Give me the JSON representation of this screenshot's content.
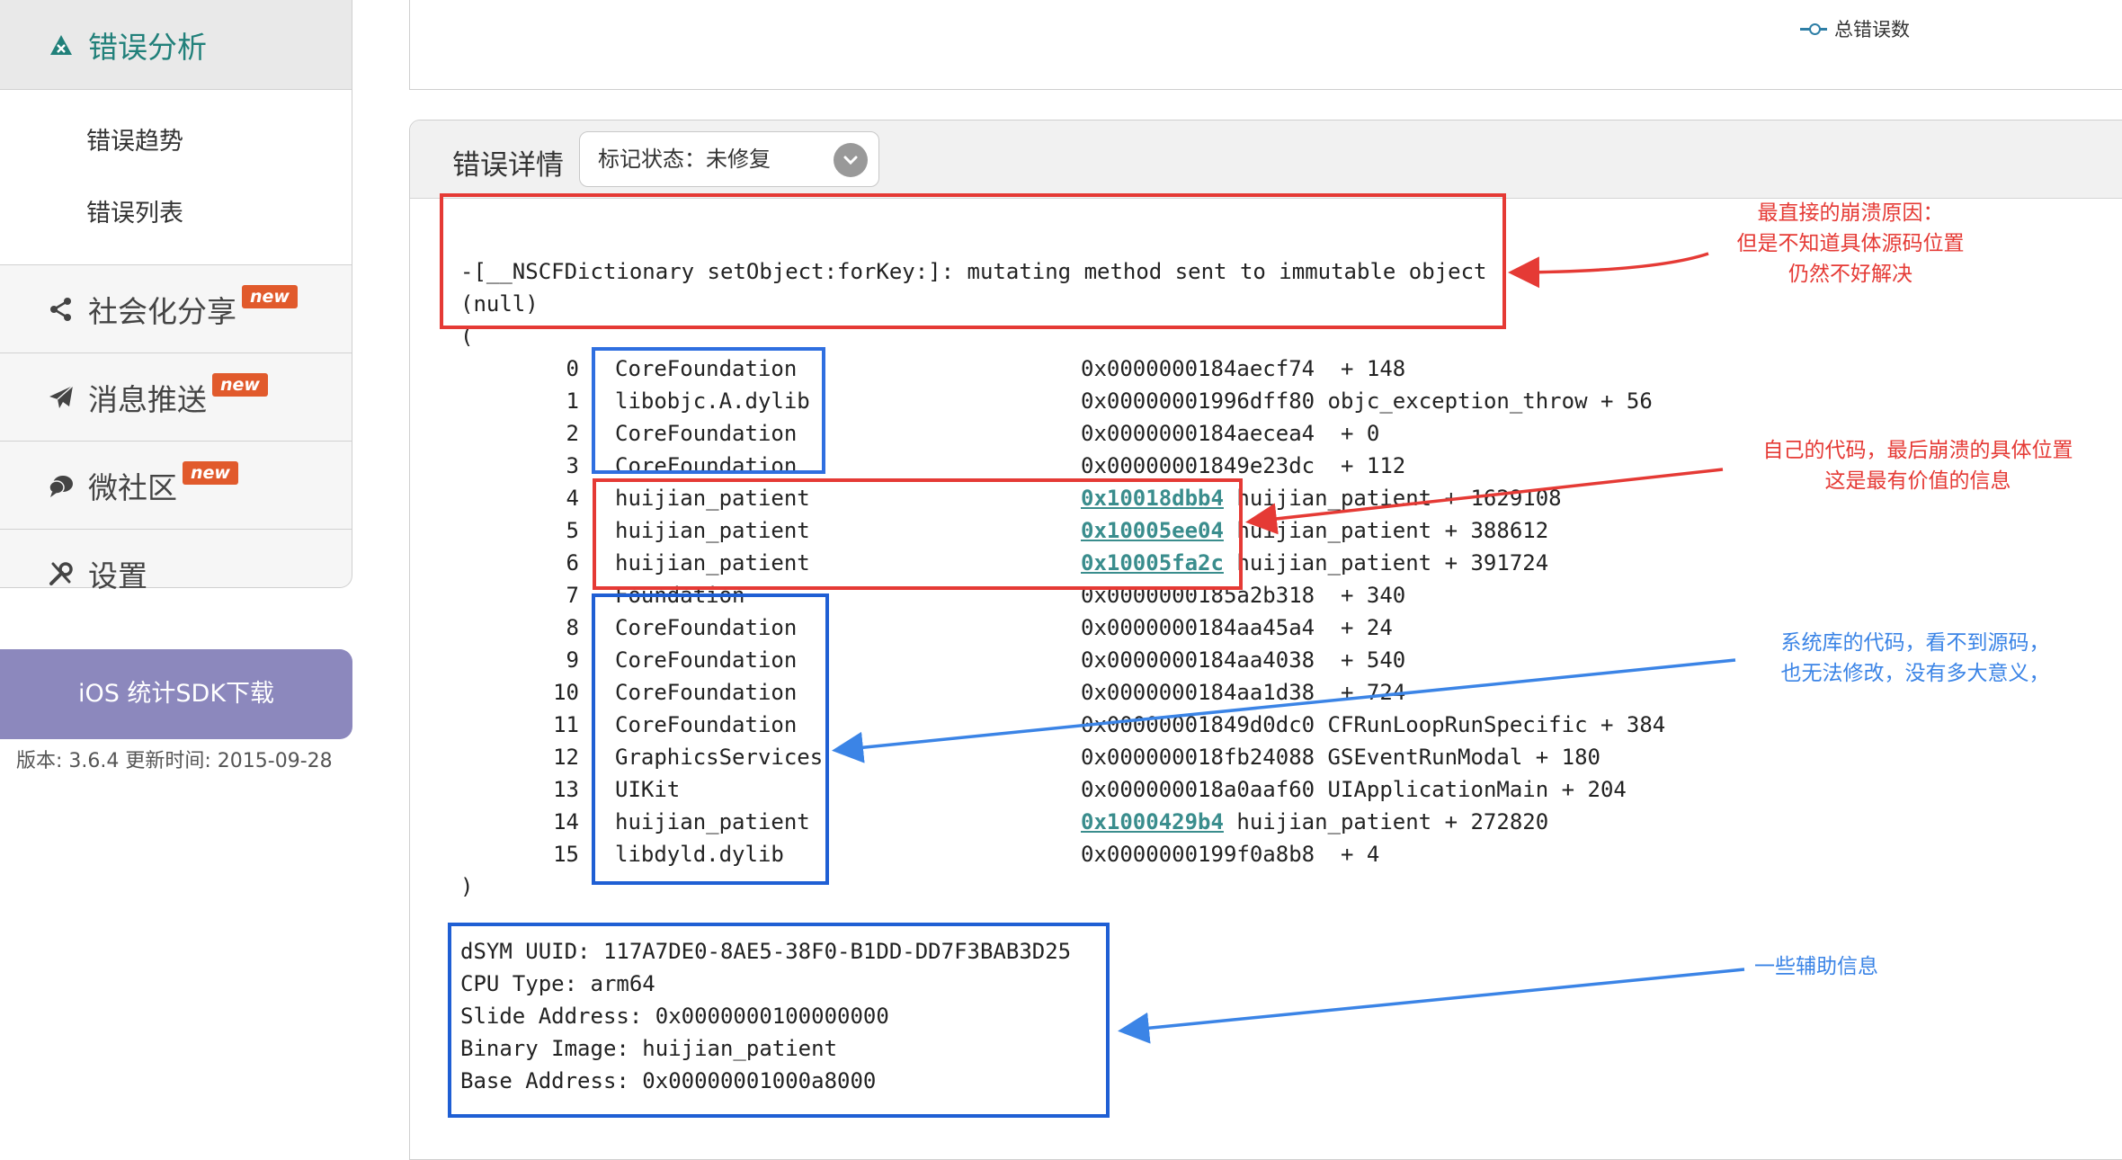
{
  "sidebar": {
    "active_item": "错误分析",
    "sub_items": [
      "错误趋势",
      "错误列表"
    ],
    "items": [
      {
        "label": "社会化分享",
        "badge": "new"
      },
      {
        "label": "消息推送",
        "badge": "new"
      },
      {
        "label": "微社区",
        "badge": "new"
      },
      {
        "label": "设置",
        "badge": ""
      }
    ],
    "sdk_button": "iOS 统计SDK下载",
    "version": "版本: 3.6.4 更新时间: 2015-09-28"
  },
  "chart": {
    "legend": "总错误数"
  },
  "detail": {
    "title": "错误详情",
    "status_select": "标记状态：未修复",
    "exception_line1": "-[__NSCFDictionary setObject:forKey:]: mutating method sent to immutable object",
    "exception_line2": "(null)",
    "open_paren": "(",
    "close_paren": ")",
    "frames": [
      {
        "idx": "0",
        "lib": "CoreFoundation",
        "addr": "0x0000000184aecf74",
        "rest": " + 148",
        "link": false
      },
      {
        "idx": "1",
        "lib": "libobjc.A.dylib",
        "addr": "0x00000001996dff80",
        "rest": "objc_exception_throw + 56",
        "link": false
      },
      {
        "idx": "2",
        "lib": "CoreFoundation",
        "addr": "0x0000000184aecea4",
        "rest": " + 0",
        "link": false
      },
      {
        "idx": "3",
        "lib": "CoreFoundation",
        "addr": "0x00000001849e23dc",
        "rest": " + 112",
        "link": false
      },
      {
        "idx": "4",
        "lib": "huijian_patient",
        "addr": "0x10018dbb4",
        "rest": "huijian_patient + 1629108",
        "link": true
      },
      {
        "idx": "5",
        "lib": "huijian_patient",
        "addr": "0x10005ee04",
        "rest": "huijian_patient + 388612",
        "link": true
      },
      {
        "idx": "6",
        "lib": "huijian_patient",
        "addr": "0x10005fa2c",
        "rest": "huijian_patient + 391724",
        "link": true
      },
      {
        "idx": "7",
        "lib": "Foundation",
        "addr": "0x0000000185a2b318",
        "rest": " + 340",
        "link": false
      },
      {
        "idx": "8",
        "lib": "CoreFoundation",
        "addr": "0x0000000184aa45a4",
        "rest": " + 24",
        "link": false
      },
      {
        "idx": "9",
        "lib": "CoreFoundation",
        "addr": "0x0000000184aa4038",
        "rest": " + 540",
        "link": false
      },
      {
        "idx": "10",
        "lib": "CoreFoundation",
        "addr": "0x0000000184aa1d38",
        "rest": " + 724",
        "link": false
      },
      {
        "idx": "11",
        "lib": "CoreFoundation",
        "addr": "0x00000001849d0dc0",
        "rest": "CFRunLoopRunSpecific + 384",
        "link": false
      },
      {
        "idx": "12",
        "lib": "GraphicsServices",
        "addr": "0x000000018fb24088",
        "rest": "GSEventRunModal + 180",
        "link": false
      },
      {
        "idx": "13",
        "lib": "UIKit",
        "addr": "0x000000018a0aaf60",
        "rest": "UIApplicationMain + 204",
        "link": false
      },
      {
        "idx": "14",
        "lib": "huijian_patient",
        "addr": "0x1000429b4",
        "rest": "huijian_patient + 272820",
        "link": true
      },
      {
        "idx": "15",
        "lib": "libdyld.dylib",
        "addr": "0x0000000199f0a8b8",
        "rest": " + 4",
        "link": false
      }
    ],
    "info": [
      "dSYM UUID: 117A7DE0-8AE5-38F0-B1DD-DD7F3BAB3D25",
      "CPU Type: arm64",
      "Slide Address: 0x0000000100000000",
      "Binary Image: huijian_patient",
      "Base Address: 0x00000001000a8000"
    ]
  },
  "annotations": {
    "crash_reason": "最直接的崩溃原因：\n但是不知道具体源码位置\n仍然不好解决",
    "own_code": "自己的代码，最后崩溃的具体位置\n这是最有价值的信息",
    "system_lib": "系统库的代码，看不到源码，\n也无法修改，没有多大意义，",
    "aux_info": "一些辅助信息",
    "colors": {
      "red": "#e53a35",
      "blue": "#3b84e6"
    }
  }
}
